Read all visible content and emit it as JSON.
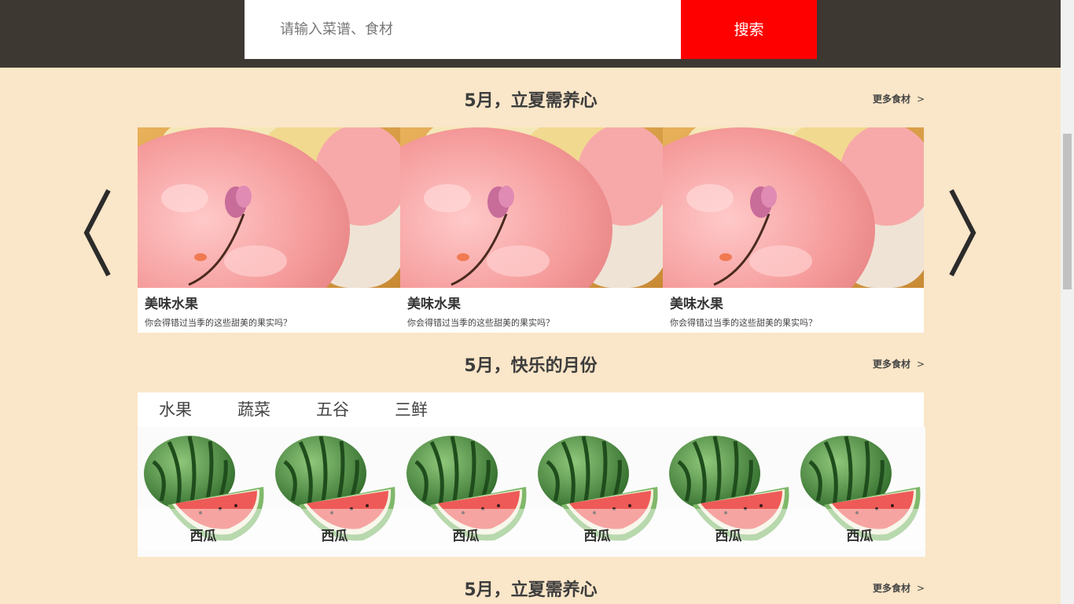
{
  "search": {
    "placeholder": "请输入菜谱、食材",
    "button_label": "搜索"
  },
  "sections": [
    {
      "title": "5月，立夏需养心",
      "more_label": "更多食材",
      "more_chevron": ">"
    },
    {
      "title": "5月，快乐的月份",
      "more_label": "更多食材",
      "more_chevron": ">"
    },
    {
      "title": "5月，立夏需养心",
      "more_label": "更多食材",
      "more_chevron": ">"
    }
  ],
  "carousel": {
    "items": [
      {
        "title": "美味水果",
        "desc": "你会得错过当季的这些甜美的果实吗？"
      },
      {
        "title": "美味水果",
        "desc": "你会得错过当季的这些甜美的果实吗？"
      },
      {
        "title": "美味水果",
        "desc": "你会得错过当季的这些甜美的果实吗？"
      }
    ],
    "prev_icon": "chevron-left-icon",
    "next_icon": "chevron-right-icon"
  },
  "categories": {
    "tabs": [
      "水果",
      "蔬菜",
      "五谷",
      "三鲜"
    ],
    "items": [
      "西瓜",
      "西瓜",
      "西瓜",
      "西瓜",
      "西瓜",
      "西瓜"
    ]
  },
  "colors": {
    "background": "#fae6c8",
    "header": "#3e3833",
    "search_button": "#ff0000"
  }
}
